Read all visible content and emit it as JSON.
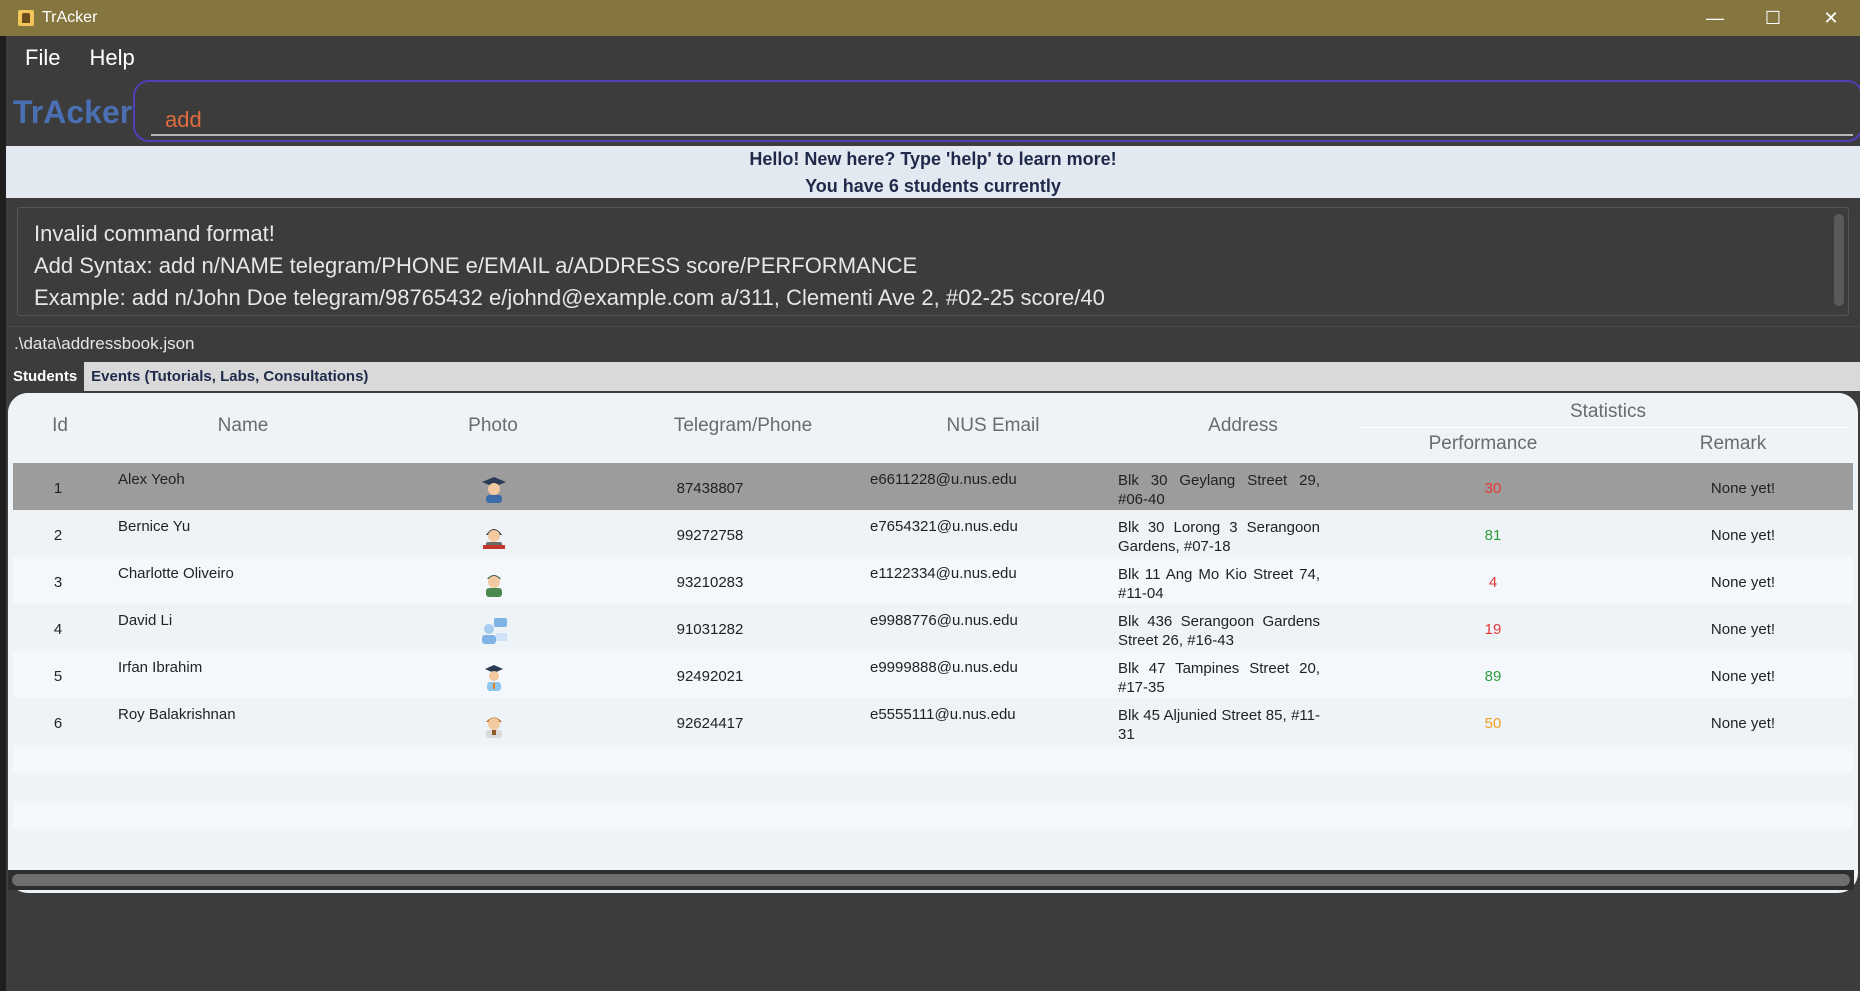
{
  "window": {
    "title": "TrAcker",
    "minimize": "—",
    "maximize": "☐",
    "close": "✕"
  },
  "menu": {
    "file": "File",
    "help": "Help"
  },
  "brand": "TrAcker",
  "command": {
    "value": "add"
  },
  "welcome": {
    "line1": "Hello! New here? Type 'help' to learn more!",
    "line2": "You have 6 students currently"
  },
  "result": {
    "line1": "Invalid command format!",
    "line2": "Add Syntax: add n/NAME telegram/PHONE e/EMAIL a/ADDRESS score/PERFORMANCE",
    "line3": "Example: add n/John Doe telegram/98765432 e/johnd@example.com a/311, Clementi Ave 2, #02-25 score/40"
  },
  "path": ".\\data\\addressbook.json",
  "tabs": {
    "students": "Students",
    "events": "Events (Tutorials, Labs, Consultations)"
  },
  "columns": {
    "id": "Id",
    "name": "Name",
    "photo": "Photo",
    "phone": "Telegram/Phone",
    "email": "NUS Email",
    "address": "Address",
    "statistics": "Statistics",
    "performance": "Performance",
    "remark": "Remark"
  },
  "rows": [
    {
      "id": "1",
      "name": "Alex Yeoh",
      "photo": "graduate-avatar-icon",
      "phone": "87438807",
      "email": "e6611228@u.nus.edu",
      "address": "Blk 30 Geylang Street 29, #06-40",
      "performance": "30",
      "perf_color": "#e53935",
      "remark": "None yet!"
    },
    {
      "id": "2",
      "name": "Bernice Yu",
      "photo": "student-reading-avatar-icon",
      "phone": "99272758",
      "email": "e7654321@u.nus.edu",
      "address": "Blk 30 Lorong 3 Serangoon Gardens, #07-18",
      "performance": "81",
      "perf_color": "#2e9e3a",
      "remark": "None yet!"
    },
    {
      "id": "3",
      "name": "Charlotte Oliveiro",
      "photo": "student-avatar-icon",
      "phone": "93210283",
      "email": "e1122334@u.nus.edu",
      "address": "Blk 11 Ang Mo Kio Street 74, #11-04",
      "performance": "4",
      "perf_color": "#e53935",
      "remark": "None yet!"
    },
    {
      "id": "4",
      "name": "David Li",
      "photo": "teacher-chat-avatar-icon",
      "phone": "91031282",
      "email": "e9988776@u.nus.edu",
      "address": "Blk 436 Serangoon Gardens Street 26, #16-43",
      "performance": "19",
      "perf_color": "#e53935",
      "remark": "None yet!"
    },
    {
      "id": "5",
      "name": "Irfan Ibrahim",
      "photo": "scholar-avatar-icon",
      "phone": "92492021",
      "email": "e9999888@u.nus.edu",
      "address": "Blk 47 Tampines Street 20, #17-35",
      "performance": "89",
      "perf_color": "#2e9e3a",
      "remark": "None yet!"
    },
    {
      "id": "6",
      "name": "Roy Balakrishnan",
      "photo": "boy-student-avatar-icon",
      "phone": "92624417",
      "email": "e5555111@u.nus.edu",
      "address": "Blk 45 Aljunied Street 85, #11-31",
      "performance": "50",
      "perf_color": "#f0a020",
      "remark": "None yet!"
    }
  ]
}
